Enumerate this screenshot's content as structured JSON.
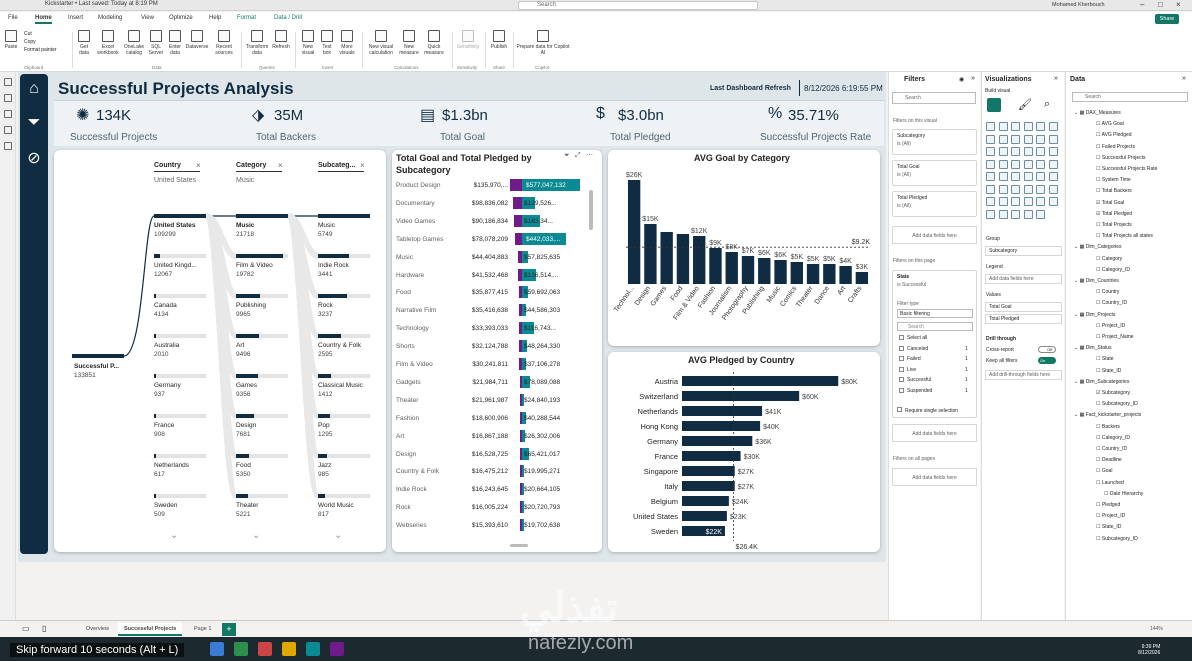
{
  "app": {
    "title": "Kickstarter • Last saved: Today at 8:19 PM",
    "search": "Search",
    "user": "Mohamed Kherbouch",
    "share": "Share"
  },
  "tabs": [
    "File",
    "Home",
    "Insert",
    "Modeling",
    "View",
    "Optimize",
    "Help",
    "Format",
    "Data / Drill"
  ],
  "ribbon": {
    "buttons": [
      "Paste",
      "Get data",
      "Excel workbook",
      "OneLake catalog",
      "SQL Server",
      "Enter data",
      "Dataverse",
      "Recent sources",
      "Transform data",
      "Refresh",
      "New visual",
      "Text box",
      "More visuals",
      "New visual calculation",
      "New measure",
      "Quick measure",
      "Sensitivity",
      "Publish",
      "Prepare data for Copilot AI"
    ],
    "clip": [
      "Cut",
      "Copy",
      "Format painter"
    ],
    "groups": [
      "Clipboard",
      "Data",
      "Queries",
      "Insert",
      "Calculations",
      "Sensitivity",
      "Share",
      "Copilot"
    ]
  },
  "report": {
    "title": "Successful Projects Analysis",
    "refresh_label": "Last Dashboard Refresh",
    "refresh_date": "8/12/2026 6:19:55 PM"
  },
  "kpis": [
    {
      "value": "134K",
      "label": "Successful Projects",
      "icon": "rocket-icon"
    },
    {
      "value": "35M",
      "label": "Total Backers",
      "icon": "backers-icon"
    },
    {
      "value": "$1.3bn",
      "label": "Total Goal",
      "icon": "goal-icon"
    },
    {
      "value": "$3.0bn",
      "label": "Total Pledged",
      "icon": "pledged-icon"
    },
    {
      "value": "35.71%",
      "label": "Successful Projects Rate",
      "icon": "rate-icon"
    }
  ],
  "decomp": {
    "root": {
      "name": "Successful P...",
      "value": "133851"
    },
    "levels": [
      {
        "header": "Country",
        "selected": "United States",
        "items": [
          {
            "name": "United States",
            "value": "109299",
            "frac": 1.0
          },
          {
            "name": "United Kingd...",
            "value": "12067",
            "frac": 0.11
          },
          {
            "name": "Canada",
            "value": "4134",
            "frac": 0.04
          },
          {
            "name": "Australia",
            "value": "2010",
            "frac": 0.02
          },
          {
            "name": "Germany",
            "value": "937",
            "frac": 0.01
          },
          {
            "name": "France",
            "value": "908",
            "frac": 0.01
          },
          {
            "name": "Netherlands",
            "value": "617",
            "frac": 0.006
          },
          {
            "name": "Sweden",
            "value": "509",
            "frac": 0.005
          }
        ]
      },
      {
        "header": "Category",
        "selected": "Music",
        "items": [
          {
            "name": "Music",
            "value": "21718",
            "frac": 1.0
          },
          {
            "name": "Film & Video",
            "value": "19782",
            "frac": 0.91
          },
          {
            "name": "Publishing",
            "value": "9965",
            "frac": 0.46
          },
          {
            "name": "Art",
            "value": "9496",
            "frac": 0.44
          },
          {
            "name": "Games",
            "value": "9356",
            "frac": 0.43
          },
          {
            "name": "Design",
            "value": "7681",
            "frac": 0.35
          },
          {
            "name": "Food",
            "value": "5350",
            "frac": 0.25
          },
          {
            "name": "Theater",
            "value": "5221",
            "frac": 0.24
          }
        ]
      },
      {
        "header": "Subcateg...",
        "selected": "",
        "items": [
          {
            "name": "Music",
            "value": "5749",
            "frac": 1.0
          },
          {
            "name": "Indie Rock",
            "value": "3441",
            "frac": 0.6
          },
          {
            "name": "Rock",
            "value": "3237",
            "frac": 0.56
          },
          {
            "name": "Country & Folk",
            "value": "2595",
            "frac": 0.45
          },
          {
            "name": "Classical Music",
            "value": "1412",
            "frac": 0.25
          },
          {
            "name": "Pop",
            "value": "1295",
            "frac": 0.23
          },
          {
            "name": "Jazz",
            "value": "985",
            "frac": 0.17
          },
          {
            "name": "World Music",
            "value": "817",
            "frac": 0.14
          }
        ]
      }
    ]
  },
  "goal_table": {
    "title": "Total Goal and Total Pledged by Subcategory",
    "rows": [
      {
        "cat": "Product Design",
        "goal": "$135,970,...",
        "pledged": "$577,047,132",
        "g": 135970000,
        "p": 577047132
      },
      {
        "cat": "Documentary",
        "goal": "$98,836,082",
        "pledged": "$129,526...",
        "g": 98836082,
        "p": 129526000
      },
      {
        "cat": "Video Games",
        "goal": "$90,186,834",
        "pledged": "$183,34...",
        "g": 90186834,
        "p": 183340000
      },
      {
        "cat": "Tabletop Games",
        "goal": "$78,078,209",
        "pledged": "$442,033,...",
        "g": 78078209,
        "p": 442033000
      },
      {
        "cat": "Music",
        "goal": "$44,404,883",
        "pledged": "$57,825,635",
        "g": 44404883,
        "p": 57825635
      },
      {
        "cat": "Hardware",
        "goal": "$41,532,468",
        "pledged": "$136,514,...",
        "g": 41532468,
        "p": 136514000
      },
      {
        "cat": "Food",
        "goal": "$35,877,415",
        "pledged": "$59,692,063",
        "g": 35877415,
        "p": 59692063
      },
      {
        "cat": "Narrative Film",
        "goal": "$35,416,638",
        "pledged": "$44,586,303",
        "g": 35416638,
        "p": 44586303
      },
      {
        "cat": "Technology",
        "goal": "$33,393,033",
        "pledged": "$116,743...",
        "g": 33393033,
        "p": 116743000
      },
      {
        "cat": "Shorts",
        "goal": "$32,124,788",
        "pledged": "$48,264,330",
        "g": 32124788,
        "p": 48264330
      },
      {
        "cat": "Film & Video",
        "goal": "$30,241,811",
        "pledged": "$37,106,278",
        "g": 30241811,
        "p": 37106278
      },
      {
        "cat": "Gadgets",
        "goal": "$21,984,711",
        "pledged": "$78,089,088",
        "g": 21984711,
        "p": 78089088
      },
      {
        "cat": "Theater",
        "goal": "$21,961,987",
        "pledged": "$24,840,193",
        "g": 21961987,
        "p": 24840193
      },
      {
        "cat": "Fashion",
        "goal": "$18,600,906",
        "pledged": "$40,288,544",
        "g": 18600906,
        "p": 40288544
      },
      {
        "cat": "Art",
        "goal": "$16,867,188",
        "pledged": "$26,302,006",
        "g": 16867188,
        "p": 26302006
      },
      {
        "cat": "Design",
        "goal": "$16,528,725",
        "pledged": "$65,421,017",
        "g": 16528725,
        "p": 65421017
      },
      {
        "cat": "Country & Folk",
        "goal": "$16,475,212",
        "pledged": "$19,995,271",
        "g": 16475212,
        "p": 19995271
      },
      {
        "cat": "Indie Rock",
        "goal": "$16,243,645",
        "pledged": "$20,664,105",
        "g": 16243645,
        "p": 20664105
      },
      {
        "cat": "Rock",
        "goal": "$16,005,224",
        "pledged": "$20,720,793",
        "g": 16005224,
        "p": 20720793
      },
      {
        "cat": "Webseries",
        "goal": "$15,393,610",
        "pledged": "$19,702,638",
        "g": 15393610,
        "p": 19702638
      }
    ]
  },
  "chart_data": [
    {
      "type": "bar",
      "title": "AVG Goal by Category",
      "orientation": "vertical",
      "categories": [
        "Technol...",
        "Design",
        "Games",
        "Food",
        "Film & Video",
        "Fashion",
        "Journalism",
        "Photography",
        "Publishing",
        "Music",
        "Comics",
        "Theater",
        "Dance",
        "Art",
        "Crafts"
      ],
      "values": [
        26000,
        15000,
        13000,
        12500,
        12000,
        9000,
        8000,
        7000,
        6500,
        6000,
        5500,
        5000,
        5000,
        4500,
        3000
      ],
      "labels": [
        "$26K",
        "$15K",
        "",
        "",
        "$12K",
        "$9K",
        "$8K",
        "$7K",
        "$6K",
        "$6K",
        "$5K",
        "$5K",
        "$5K",
        "$4K",
        "$3K"
      ],
      "reference": {
        "value": 9200,
        "label": "$9.2K"
      },
      "ylim": [
        0,
        28000
      ],
      "color": "#0f2c42"
    },
    {
      "type": "bar",
      "title": "AVG Pledged by Country",
      "orientation": "horizontal",
      "categories": [
        "Austria",
        "Switzerland",
        "Netherlands",
        "Hong Kong",
        "Germany",
        "France",
        "Singapore",
        "Italy",
        "Belgium",
        "United States",
        "Sweden"
      ],
      "values": [
        80000,
        60000,
        41000,
        40000,
        36000,
        30000,
        27000,
        27000,
        24000,
        23000,
        22000
      ],
      "labels": [
        "$80K",
        "$60K",
        "$41K",
        "$40K",
        "$36K",
        "$30K",
        "$27K",
        "$27K",
        "$24K",
        "$23K",
        "$22K"
      ],
      "reference": {
        "value": 26400,
        "label": "$26.4K"
      },
      "xlim": [
        0,
        85000
      ],
      "color": "#0f2c42"
    }
  ],
  "filters": {
    "title": "Filters",
    "search": "Search",
    "on_visual": "Filters on this visual",
    "cards": [
      {
        "name": "Subcategory",
        "value": "is (All)"
      },
      {
        "name": "Total Goal",
        "value": "is (All)"
      },
      {
        "name": "Total Pledged",
        "value": "is (All)"
      }
    ],
    "add": "Add data fields here",
    "on_page": "Filters on this page",
    "state": {
      "name": "State",
      "value": "is Successful",
      "type_label": "Filter type",
      "type": "Basic filtering",
      "search": "Search"
    },
    "options": [
      {
        "label": "Select all",
        "count": ""
      },
      {
        "label": "Canceled",
        "count": "1"
      },
      {
        "label": "Failed",
        "count": "1"
      },
      {
        "label": "Live",
        "count": "1"
      },
      {
        "label": "Successful",
        "count": "1"
      },
      {
        "label": "Suspended",
        "count": "1"
      }
    ],
    "require": "Require single selection",
    "on_all": "Filters on all pages"
  },
  "viz": {
    "title": "Visualizations",
    "build": "Build visual",
    "group": "Group",
    "group_field": "Subcategory",
    "legend": "Legend",
    "legend_add": "Add data fields here",
    "values": "Values",
    "values_fields": [
      "Total Goal",
      "Total Pledged"
    ],
    "drill": "Drill through",
    "cross": "Cross-report",
    "cross_state": "Off",
    "keep": "Keep all filters",
    "keep_state": "On",
    "drill_add": "Add drill-through fields here"
  },
  "datap": {
    "title": "Data",
    "search": "Search",
    "tree": [
      "DAX_Measures",
      "AVG Goal",
      "AVG Pledged",
      "Failed Projects",
      "Successful Projects",
      "Successful Projects Rate",
      "System Time",
      "Total Backers",
      "Total Goal",
      "Total Pledged",
      "Total Projects",
      "Total Projects all states",
      "Dim_Categories",
      "Category",
      "Category_ID",
      "Dim_Countries",
      "Country",
      "Country_ID",
      "Dim_Projects",
      "Project_ID",
      "Project_Name",
      "Dim_Status",
      "State",
      "State_ID",
      "Dim_Subcategories",
      "Subcategory",
      "Subcategory_ID",
      "Fact_kickstarter_projects",
      "Backers",
      "Category_ID",
      "Country_ID",
      "Deadline",
      "Goal",
      "Launched",
      "Date Hierarchy",
      "Pledged",
      "Project_ID",
      "State_ID",
      "Subcategory_ID"
    ]
  },
  "pages": {
    "tabs": [
      "Overview",
      "Successful Projects",
      "Page 1"
    ],
    "zoom": "144%"
  },
  "overlay": {
    "skip": "Skip forward 10 seconds (Alt + L)",
    "wm_ar": "تفذلي",
    "wm_en": "nafezly.com",
    "time": "9:39 PM",
    "date": "8/12/2026"
  }
}
